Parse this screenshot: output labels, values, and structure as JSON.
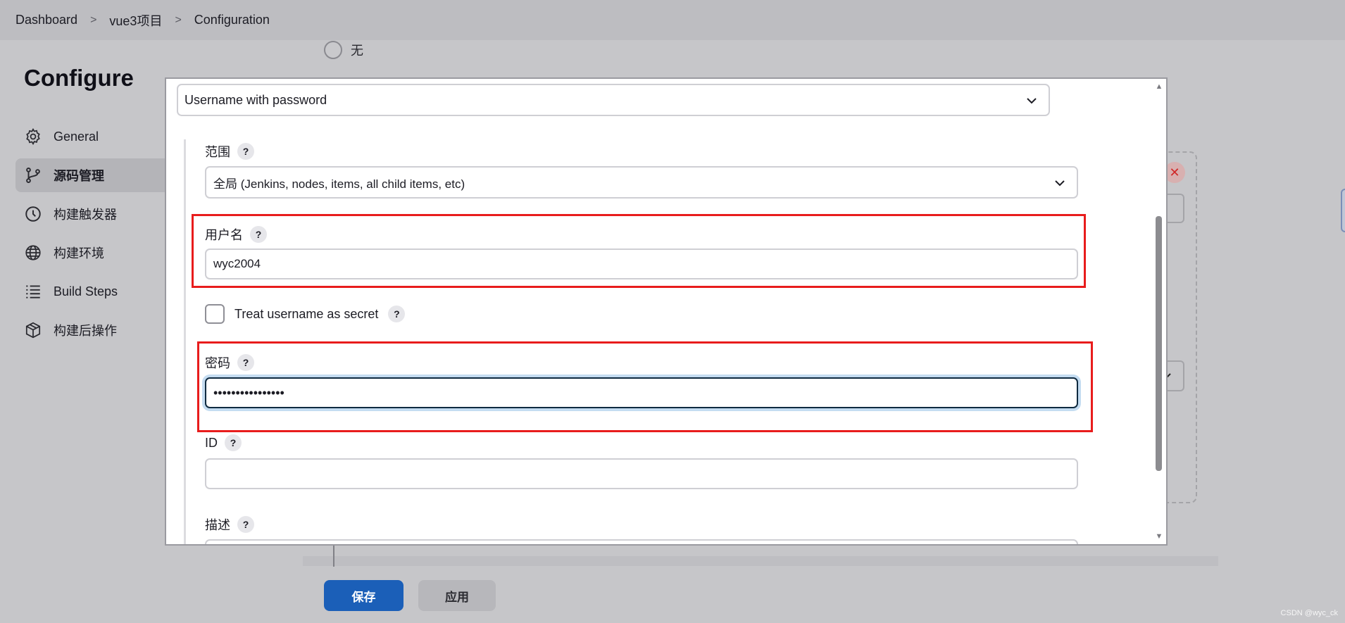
{
  "breadcrumb": {
    "items": [
      "Dashboard",
      "vue3项目",
      "Configuration"
    ],
    "separator": ">"
  },
  "page": {
    "title": "Configure"
  },
  "sidebar": {
    "items": [
      {
        "label": "General",
        "icon": "gear-icon"
      },
      {
        "label": "源码管理",
        "icon": "branch-icon",
        "active": true
      },
      {
        "label": "构建触发器",
        "icon": "clock-icon"
      },
      {
        "label": "构建环境",
        "icon": "globe-icon"
      },
      {
        "label": "Build Steps",
        "icon": "list-icon"
      },
      {
        "label": "构建后操作",
        "icon": "package-icon"
      }
    ]
  },
  "background": {
    "radio_label": "无",
    "save_label": "保存",
    "apply_label": "应用",
    "watermark": "CSDN @wyc_ck",
    "close_icon": "close-icon"
  },
  "dialog": {
    "kind": {
      "value": "Username with password"
    },
    "scope": {
      "label": "范围",
      "value": "全局 (Jenkins, nodes, items, all child items, etc)"
    },
    "username": {
      "label": "用户名",
      "value": "wyc2004"
    },
    "username_secret": {
      "label": "Treat username as secret",
      "checked": false
    },
    "password": {
      "label": "密码",
      "value": "••••••••••••••••"
    },
    "id": {
      "label": "ID",
      "value": ""
    },
    "description": {
      "label": "描述",
      "value": ""
    },
    "help_symbol": "?"
  },
  "colors": {
    "highlight": "#e81c1c",
    "primary_button": "#1b5fb8",
    "focus_ring": "#c4dcf1"
  }
}
